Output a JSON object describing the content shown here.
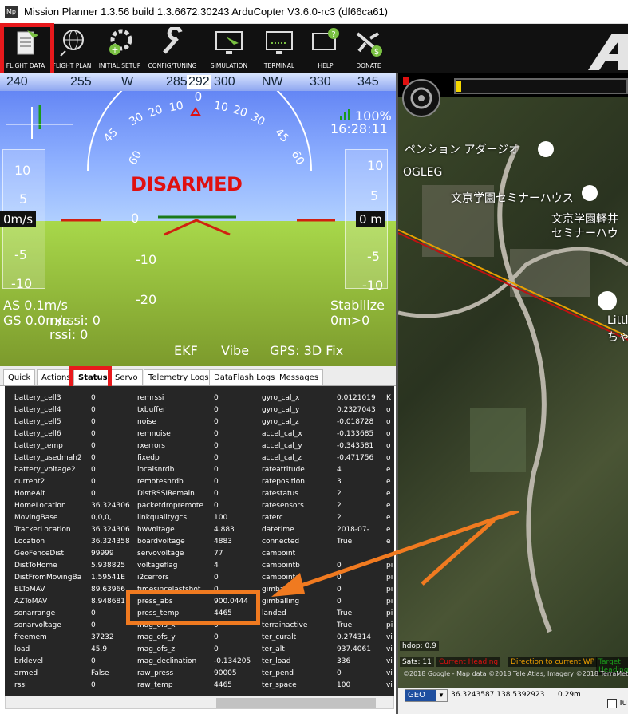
{
  "window": {
    "title": "Mission Planner 1.3.56 build 1.3.6672.30243 ArduCopter V3.6.0-rc3 (df66ca61)",
    "icon_label": "Mp"
  },
  "toolbar": {
    "items": [
      "FLIGHT DATA",
      "FLIGHT PLAN",
      "INITIAL SETUP",
      "CONFIG/TUNING",
      "SIMULATION",
      "TERMINAL",
      "HELP",
      "DONATE"
    ]
  },
  "hud": {
    "compass": [
      "240",
      "255",
      "W",
      "285",
      "292",
      "300",
      "NW",
      "330",
      "345"
    ],
    "pitch_labels": [
      "10",
      "5",
      "0",
      "-5",
      "-10"
    ],
    "roll_labels": [
      "60",
      "45",
      "30",
      "20",
      "10",
      "0",
      "10",
      "20",
      "30",
      "45",
      "60"
    ],
    "pitch_ladder": [
      "0",
      "-10",
      "-20"
    ],
    "speed_tape": [
      "10",
      "5",
      "-5",
      "-10"
    ],
    "alt_tape": [
      "10",
      "5",
      "-5",
      "-10"
    ],
    "speed_box": "0m/s",
    "alt_box": "0 m",
    "disarmed": "DISARMED",
    "battery": "100%",
    "time": "16:28:11",
    "airspeed": "AS 0.1m/s",
    "groundspeed": "GS 0.0m/s",
    "rxrssi": "rxrssi: 0",
    "rssi": "rssi: 0",
    "mode": "Stabilize",
    "wp": "0m>0",
    "ekf": "EKF",
    "vibe": "Vibe",
    "gps": "GPS: 3D Fix"
  },
  "tabs": [
    "Quick",
    "Actions",
    "Status",
    "Servo",
    "Telemetry Logs",
    "DataFlash Logs",
    "Messages"
  ],
  "status_rows": [
    [
      "battery_cell3",
      "0",
      "remrssi",
      "0",
      "gyro_cal_x",
      "0.0121019",
      "K"
    ],
    [
      "battery_cell4",
      "0",
      "txbuffer",
      "0",
      "gyro_cal_y",
      "0.2327043",
      "o"
    ],
    [
      "battery_cell5",
      "0",
      "noise",
      "0",
      "gyro_cal_z",
      "-0.018728",
      "o"
    ],
    [
      "battery_cell6",
      "0",
      "remnoise",
      "0",
      "accel_cal_x",
      "-0.133685",
      "o"
    ],
    [
      "battery_temp",
      "0",
      "rxerrors",
      "0",
      "accel_cal_y",
      "-0.343581",
      "o"
    ],
    [
      "battery_usedmah2",
      "0",
      "fixedp",
      "0",
      "accel_cal_z",
      "-0.471756",
      "o"
    ],
    [
      "battery_voltage2",
      "0",
      "localsnrdb",
      "0",
      "rateattitude",
      "4",
      "e"
    ],
    [
      "current2",
      "0",
      "remotesnrdb",
      "0",
      "rateposition",
      "3",
      "e"
    ],
    [
      "HomeAlt",
      "0",
      "DistRSSIRemain",
      "0",
      "ratestatus",
      "2",
      "e"
    ],
    [
      "HomeLocation",
      "36.324306",
      "packetdropremote",
      "0",
      "ratesensors",
      "2",
      "e"
    ],
    [
      "MovingBase",
      "0,0,0,",
      "linkqualitygcs",
      "100",
      "raterc",
      "2",
      "e"
    ],
    [
      "TrackerLocation",
      "36.324306",
      "hwvoltage",
      "4.883",
      "datetime",
      "2018-07-",
      "e"
    ],
    [
      "Location",
      "36.324358",
      "boardvoltage",
      "4883",
      "connected",
      "True",
      "e"
    ],
    [
      "GeoFenceDist",
      "99999",
      "servovoltage",
      "77",
      "campoint",
      "",
      ""
    ],
    [
      "DistToHome",
      "5.938825",
      "voltageflag",
      "4",
      "campointb",
      "0",
      "pi"
    ],
    [
      "DistFromMovingBa",
      "1.59541E",
      "i2cerrors",
      "0",
      "campointc",
      "0",
      "pi"
    ],
    [
      "ELToMAV",
      "89.63966",
      "timesincelastshot",
      "0",
      "gimbalsr",
      "0",
      "pi"
    ],
    [
      "AZToMAV",
      "8.948681",
      "press_abs",
      "900.0444",
      "gimballing",
      "0",
      "pi"
    ],
    [
      "sonarrange",
      "0",
      "press_temp",
      "4465",
      "landed",
      "True",
      "pi"
    ],
    [
      "sonarvoltage",
      "0",
      "mag_ofs_x",
      "0",
      "terrainactive",
      "True",
      "pi"
    ],
    [
      "freemem",
      "37232",
      "mag_ofs_y",
      "0",
      "ter_curalt",
      "0.274314",
      "vi"
    ],
    [
      "load",
      "45.9",
      "mag_ofs_z",
      "0",
      "ter_alt",
      "937.4061",
      "vi"
    ],
    [
      "brklevel",
      "0",
      "mag_declination",
      "-0.134205",
      "ter_load",
      "336",
      "vi"
    ],
    [
      "armed",
      "False",
      "raw_press",
      "90005",
      "ter_pend",
      "0",
      "vi"
    ],
    [
      "rssi",
      "0",
      "raw_temp",
      "4465",
      "ter_space",
      "100",
      "vi"
    ]
  ],
  "map": {
    "labels": [
      "ペンション アダージオ",
      "OGLEG",
      "文京学園セミナーハウス",
      "文京学園軽井",
      "セミナーハウ",
      "Little D",
      "ちゃん"
    ],
    "hdop": "hdop: 0.9",
    "sats": "Sats: 11",
    "legend": [
      "Current Heading",
      "Direction to current WP",
      "Target Heading"
    ],
    "copyright": "©2018 Google - Map data ©2018 Tele Atlas, Imagery ©2018 TerraMetrics",
    "coord_type": "GEO",
    "coords": "36.3243587 138.5392923",
    "alt_readout": "0.29m",
    "checkbox_label": "Tu"
  },
  "colors": {
    "highlight_red": "#e8191c",
    "arrow_orange": "#f07a20",
    "disarmed": "#e01010"
  }
}
